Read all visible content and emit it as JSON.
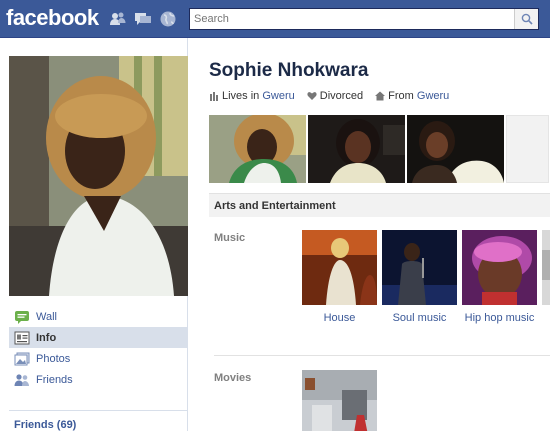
{
  "topbar": {
    "logo": "facebook",
    "jewels": [
      "friend-requests-icon",
      "messages-icon",
      "notifications-globe-icon"
    ],
    "search_placeholder": "Search",
    "colors": {
      "bar": "#3b5998",
      "link": "#3b5998"
    }
  },
  "profile": {
    "name": "Sophie Nhokwara",
    "lives_in_prefix": "Lives in",
    "lives_in": "Gweru",
    "relationship": "Divorced",
    "from_prefix": "From",
    "from": "Gweru"
  },
  "nav": {
    "items": [
      {
        "label": "Wall",
        "icon": "wall-icon"
      },
      {
        "label": "Info",
        "icon": "info-icon",
        "active": true
      },
      {
        "label": "Photos",
        "icon": "photos-icon"
      },
      {
        "label": "Friends",
        "icon": "friends-icon"
      }
    ],
    "friends_link": "Friends (69)"
  },
  "section": {
    "title": "Arts and Entertainment",
    "music_label": "Music",
    "music": [
      {
        "label": "House"
      },
      {
        "label": "Soul music"
      },
      {
        "label": "Hip hop music"
      }
    ],
    "movies_label": "Movies"
  }
}
